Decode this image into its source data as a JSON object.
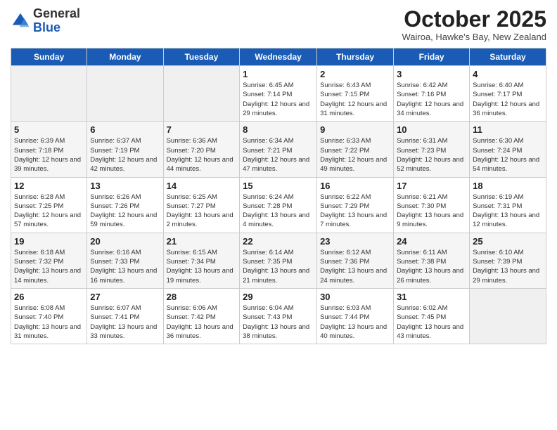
{
  "header": {
    "logo_general": "General",
    "logo_blue": "Blue",
    "month_title": "October 2025",
    "subtitle": "Wairoa, Hawke's Bay, New Zealand"
  },
  "days": [
    "Sunday",
    "Monday",
    "Tuesday",
    "Wednesday",
    "Thursday",
    "Friday",
    "Saturday"
  ],
  "weeks": [
    [
      {
        "date": "",
        "info": ""
      },
      {
        "date": "",
        "info": ""
      },
      {
        "date": "",
        "info": ""
      },
      {
        "date": "1",
        "info": "Sunrise: 6:45 AM\nSunset: 7:14 PM\nDaylight: 12 hours and 29 minutes."
      },
      {
        "date": "2",
        "info": "Sunrise: 6:43 AM\nSunset: 7:15 PM\nDaylight: 12 hours and 31 minutes."
      },
      {
        "date": "3",
        "info": "Sunrise: 6:42 AM\nSunset: 7:16 PM\nDaylight: 12 hours and 34 minutes."
      },
      {
        "date": "4",
        "info": "Sunrise: 6:40 AM\nSunset: 7:17 PM\nDaylight: 12 hours and 36 minutes."
      }
    ],
    [
      {
        "date": "5",
        "info": "Sunrise: 6:39 AM\nSunset: 7:18 PM\nDaylight: 12 hours and 39 minutes."
      },
      {
        "date": "6",
        "info": "Sunrise: 6:37 AM\nSunset: 7:19 PM\nDaylight: 12 hours and 42 minutes."
      },
      {
        "date": "7",
        "info": "Sunrise: 6:36 AM\nSunset: 7:20 PM\nDaylight: 12 hours and 44 minutes."
      },
      {
        "date": "8",
        "info": "Sunrise: 6:34 AM\nSunset: 7:21 PM\nDaylight: 12 hours and 47 minutes."
      },
      {
        "date": "9",
        "info": "Sunrise: 6:33 AM\nSunset: 7:22 PM\nDaylight: 12 hours and 49 minutes."
      },
      {
        "date": "10",
        "info": "Sunrise: 6:31 AM\nSunset: 7:23 PM\nDaylight: 12 hours and 52 minutes."
      },
      {
        "date": "11",
        "info": "Sunrise: 6:30 AM\nSunset: 7:24 PM\nDaylight: 12 hours and 54 minutes."
      }
    ],
    [
      {
        "date": "12",
        "info": "Sunrise: 6:28 AM\nSunset: 7:25 PM\nDaylight: 12 hours and 57 minutes."
      },
      {
        "date": "13",
        "info": "Sunrise: 6:26 AM\nSunset: 7:26 PM\nDaylight: 12 hours and 59 minutes."
      },
      {
        "date": "14",
        "info": "Sunrise: 6:25 AM\nSunset: 7:27 PM\nDaylight: 13 hours and 2 minutes."
      },
      {
        "date": "15",
        "info": "Sunrise: 6:24 AM\nSunset: 7:28 PM\nDaylight: 13 hours and 4 minutes."
      },
      {
        "date": "16",
        "info": "Sunrise: 6:22 AM\nSunset: 7:29 PM\nDaylight: 13 hours and 7 minutes."
      },
      {
        "date": "17",
        "info": "Sunrise: 6:21 AM\nSunset: 7:30 PM\nDaylight: 13 hours and 9 minutes."
      },
      {
        "date": "18",
        "info": "Sunrise: 6:19 AM\nSunset: 7:31 PM\nDaylight: 13 hours and 12 minutes."
      }
    ],
    [
      {
        "date": "19",
        "info": "Sunrise: 6:18 AM\nSunset: 7:32 PM\nDaylight: 13 hours and 14 minutes."
      },
      {
        "date": "20",
        "info": "Sunrise: 6:16 AM\nSunset: 7:33 PM\nDaylight: 13 hours and 16 minutes."
      },
      {
        "date": "21",
        "info": "Sunrise: 6:15 AM\nSunset: 7:34 PM\nDaylight: 13 hours and 19 minutes."
      },
      {
        "date": "22",
        "info": "Sunrise: 6:14 AM\nSunset: 7:35 PM\nDaylight: 13 hours and 21 minutes."
      },
      {
        "date": "23",
        "info": "Sunrise: 6:12 AM\nSunset: 7:36 PM\nDaylight: 13 hours and 24 minutes."
      },
      {
        "date": "24",
        "info": "Sunrise: 6:11 AM\nSunset: 7:38 PM\nDaylight: 13 hours and 26 minutes."
      },
      {
        "date": "25",
        "info": "Sunrise: 6:10 AM\nSunset: 7:39 PM\nDaylight: 13 hours and 29 minutes."
      }
    ],
    [
      {
        "date": "26",
        "info": "Sunrise: 6:08 AM\nSunset: 7:40 PM\nDaylight: 13 hours and 31 minutes."
      },
      {
        "date": "27",
        "info": "Sunrise: 6:07 AM\nSunset: 7:41 PM\nDaylight: 13 hours and 33 minutes."
      },
      {
        "date": "28",
        "info": "Sunrise: 6:06 AM\nSunset: 7:42 PM\nDaylight: 13 hours and 36 minutes."
      },
      {
        "date": "29",
        "info": "Sunrise: 6:04 AM\nSunset: 7:43 PM\nDaylight: 13 hours and 38 minutes."
      },
      {
        "date": "30",
        "info": "Sunrise: 6:03 AM\nSunset: 7:44 PM\nDaylight: 13 hours and 40 minutes."
      },
      {
        "date": "31",
        "info": "Sunrise: 6:02 AM\nSunset: 7:45 PM\nDaylight: 13 hours and 43 minutes."
      },
      {
        "date": "",
        "info": ""
      }
    ]
  ]
}
